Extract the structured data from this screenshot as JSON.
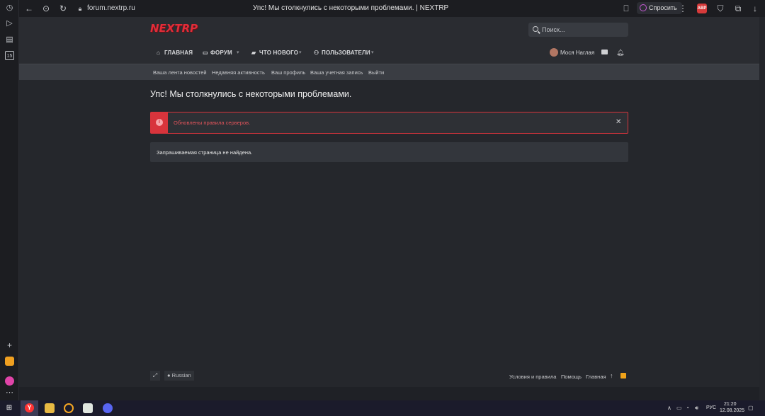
{
  "browser": {
    "url": "forum.nextrp.ru",
    "tab_title": "Упс! Мы столкнулись с некоторыми проблемами. | NEXTRP",
    "ask_button": "Спросить",
    "adblock_badge": "ABP"
  },
  "header": {
    "logo": "NEXTRP",
    "search_placeholder": "Поиск...",
    "nav": [
      {
        "label": "ГЛАВНАЯ",
        "icon": "home-icon"
      },
      {
        "label": "ФОРУМ",
        "icon": "forum-icon"
      },
      {
        "label": "ЧТО НОВОГО",
        "icon": "comment-icon"
      },
      {
        "label": "ПОЛЬЗОВАТЕЛИ",
        "icon": "users-icon"
      }
    ],
    "user_name": "Мося Наглая"
  },
  "subnav": [
    "Ваша лента новостей",
    "Недавняя активность",
    "Ваш профиль",
    "Ваша учетная запись",
    "Выйти"
  ],
  "main": {
    "title": "Упс! Мы столкнулись с некоторыми проблемами.",
    "alert_text": "Обновлены правила серверов.",
    "notice_text": "Запрашиваемая страница не найдена."
  },
  "footer": {
    "language": "Russian",
    "links": [
      "Условия и правила",
      "Помощь",
      "Главная"
    ]
  },
  "taskbar": {
    "language": "РУС",
    "time": "21:20",
    "date": "12.08.2025"
  },
  "colors": {
    "accent_red": "#d8343c",
    "logo_red": "#e12d39",
    "rss_orange": "#f0a31a"
  }
}
